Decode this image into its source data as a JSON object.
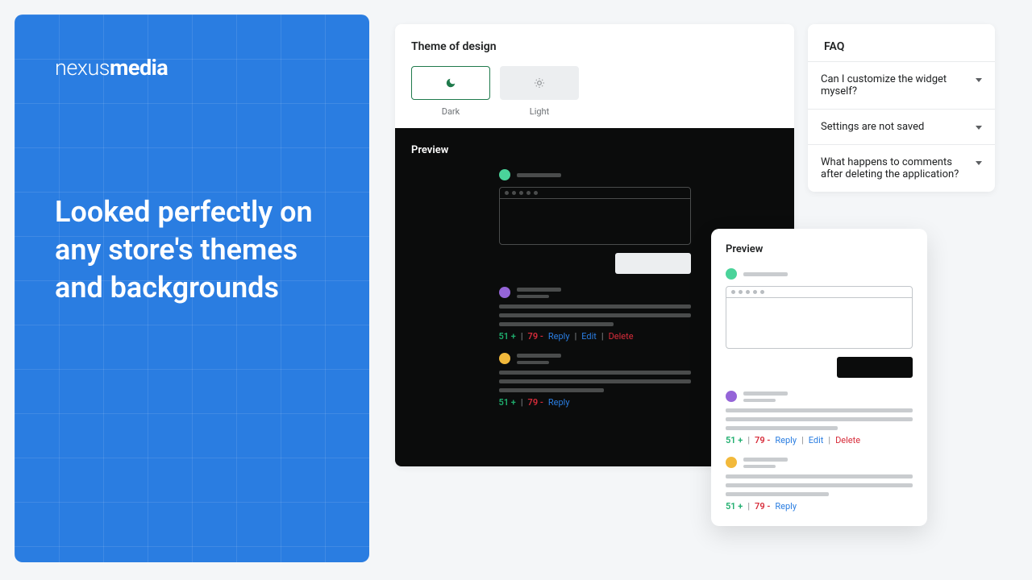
{
  "hero": {
    "logo_prefix": "nexus",
    "logo_bold": "media",
    "headline": "Looked perfectly on any store's themes and backgrounds"
  },
  "settings": {
    "title": "Theme of design",
    "options": {
      "dark": "Dark",
      "light": "Light"
    },
    "preview_label": "Preview"
  },
  "faq": {
    "title": "FAQ",
    "items": [
      "Can I customize the widget myself?",
      "Settings are not saved",
      "What happens to comments after deleting the application?"
    ]
  },
  "comment_meta": {
    "upvotes": "51 +",
    "downvotes": "79 -",
    "reply": "Reply",
    "edit": "Edit",
    "delete": "Delete"
  }
}
